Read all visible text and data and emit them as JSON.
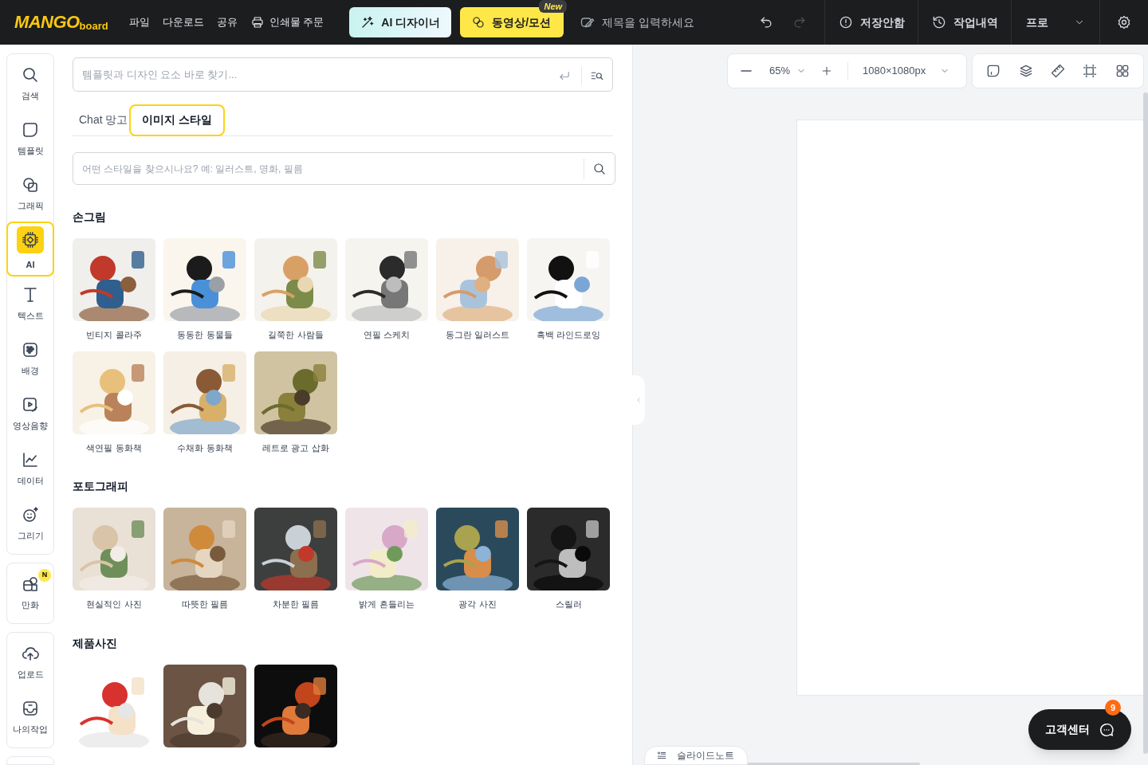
{
  "header": {
    "logo": {
      "main": "MANGO",
      "sub": "board"
    },
    "menu": [
      {
        "label": "파일",
        "kind": "text"
      },
      {
        "label": "다운로드",
        "kind": "text"
      },
      {
        "label": "공유",
        "kind": "text"
      },
      {
        "label": "인쇄물 주문",
        "kind": "print"
      }
    ],
    "ai_button": "AI 디자이너",
    "video_button": {
      "label": "동영상/모션",
      "badge": "New"
    },
    "title_field": {
      "placeholder": "제목을 입력하세요"
    },
    "undo": {
      "disabled": false
    },
    "redo": {
      "disabled": true
    },
    "save_status": "저장안함",
    "history": "작업내역",
    "plan": "프로"
  },
  "sidebar": [
    [
      {
        "label": "검색",
        "selected": false
      },
      {
        "label": "템플릿",
        "selected": false
      },
      {
        "label": "그래픽",
        "selected": false
      },
      {
        "label": "AI",
        "selected": true
      },
      {
        "label": "텍스트",
        "selected": false
      },
      {
        "label": "배경",
        "selected": false
      },
      {
        "label": "영상음향",
        "selected": false
      },
      {
        "label": "데이터",
        "selected": false
      },
      {
        "label": "그리기",
        "selected": false
      }
    ],
    [
      {
        "label": "만화",
        "selected": false,
        "badge": "N"
      }
    ],
    [
      {
        "label": "업로드",
        "selected": false
      },
      {
        "label": "나의작업",
        "selected": false
      }
    ]
  ],
  "panel": {
    "search": {
      "placeholder": "템플릿과 디자인 요소 바로 찾기..."
    },
    "tabs": [
      {
        "label": "Chat 망고",
        "selected": false
      },
      {
        "label": "이미지 스타일",
        "selected": true
      }
    ],
    "style_search": {
      "placeholder": "어떤 스타일을 찾으시나요? 예: 일러스트, 명화, 필름"
    },
    "sections": [
      {
        "title": "손그림",
        "items": [
          {
            "kind": "style",
            "label": "빈티지 콜라주"
          },
          {
            "kind": "style",
            "label": "동동한 동물들"
          },
          {
            "kind": "style",
            "label": "길쭉한 사람들"
          },
          {
            "kind": "style",
            "label": "연필 스케치"
          },
          {
            "kind": "style",
            "label": "동그란 일러스트"
          },
          {
            "kind": "style",
            "label": "흑백 라인드로잉"
          },
          {
            "kind": "style",
            "label": "색연필 동화책"
          },
          {
            "kind": "style",
            "label": "수채화 동화책"
          },
          {
            "kind": "style",
            "label": "레트로 광고 삽화"
          }
        ]
      },
      {
        "title": "포토그래피",
        "items": [
          {
            "kind": "style",
            "label": "현실적인 사진"
          },
          {
            "kind": "style",
            "label": "따뜻한 필름"
          },
          {
            "kind": "style",
            "label": "차분한 필름"
          },
          {
            "kind": "style",
            "label": "밝게 흔들리는"
          },
          {
            "kind": "style",
            "label": "광각 사진"
          },
          {
            "kind": "style",
            "label": "스릴러"
          }
        ]
      },
      {
        "title": "제품사진"
      }
    ]
  },
  "canvas_toolbar": {
    "zoom": "65%",
    "size": "1080×1080px"
  },
  "slide_note": "슬라이드노트",
  "support": {
    "label": "고객센터",
    "badge": "9"
  }
}
